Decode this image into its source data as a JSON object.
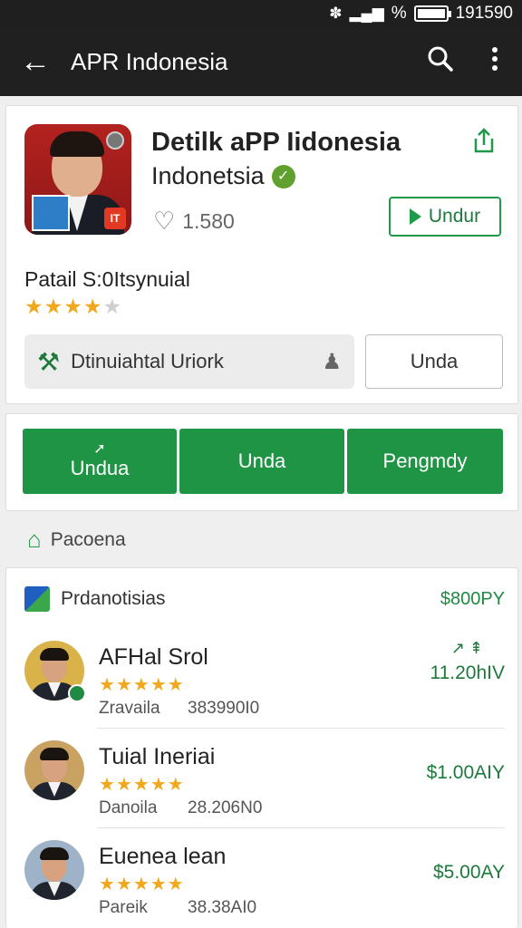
{
  "status": {
    "icons": [
      "wifi-icon",
      "signal-icon"
    ],
    "percent": "%",
    "time": "191590",
    "battery_level": 1.0
  },
  "appbar": {
    "title": "APR Indonesia",
    "back_icon": "arrow-left-icon",
    "search_icon": "search-icon",
    "menu_icon": "more-vert-icon"
  },
  "app": {
    "name": "Detilk aPP Iidonesia",
    "developer": "Indonetsia",
    "likes": "1.580",
    "install_label": "Undur",
    "subtitle": "Patail S:0Itsynuial",
    "rating": 4,
    "search_label": "Dtinuiahtal Uriork",
    "side_button": "Unda"
  },
  "actions": [
    {
      "label": "Undua"
    },
    {
      "label": "Unda"
    },
    {
      "label": "Pengmdy"
    }
  ],
  "section": {
    "title": "Pacoena"
  },
  "list": {
    "header_label": "Prdanotisias",
    "header_price": "$800PY",
    "items": [
      {
        "name": "AFHal Srol",
        "rating": 5,
        "meta1": "Zravaila",
        "meta2": "383990I0",
        "price": "11.20hIV",
        "trend": "↗ ⇞"
      },
      {
        "name": "Tuial Ineriai",
        "rating": 5,
        "meta1": "Danoila",
        "meta2": "28.206N0",
        "price": "$1.00AIY",
        "trend": ""
      },
      {
        "name": "Euenea lean",
        "rating": 5,
        "meta1": "Pareik",
        "meta2": "38.38AI0",
        "price": "$5.00AY",
        "trend": ""
      }
    ]
  },
  "colors": {
    "brand_green": "#1f9444",
    "appbar": "#202020",
    "star": "#f0a81e"
  }
}
